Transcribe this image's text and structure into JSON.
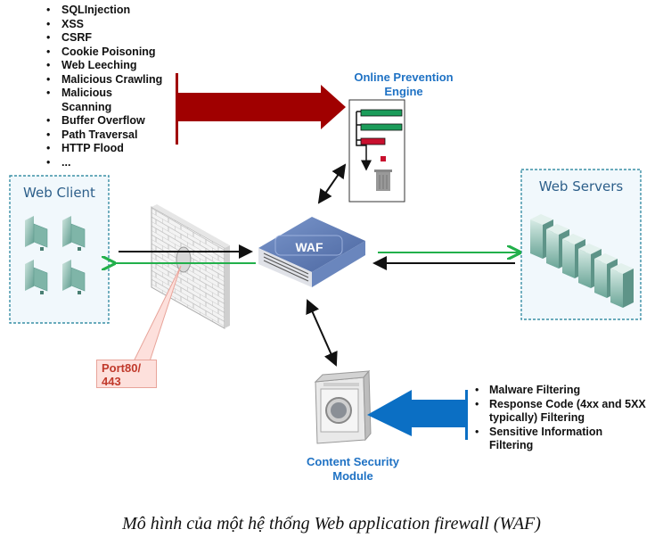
{
  "threats": {
    "items": [
      "SQLInjection",
      "XSS",
      "CSRF",
      "Cookie Poisoning",
      "Web Leeching",
      "Malicious Crawling",
      "Malicious Scanning",
      "Buffer Overflow",
      "Path Traversal",
      "HTTP Flood",
      "..."
    ]
  },
  "online_prevention_engine": {
    "label": "Online Prevention Engine"
  },
  "web_client": {
    "label": "Web Client",
    "client_count": 4
  },
  "web_servers": {
    "label": "Web Servers",
    "server_count": 6
  },
  "waf": {
    "label": "WAF"
  },
  "port": {
    "label_line1": "Port80/",
    "label_line2": "443"
  },
  "content_security_module": {
    "label": "Content Security Module"
  },
  "filters": {
    "items": [
      "Malware Filtering",
      "Response Code (4xx and 5XX typically) Filtering",
      "Sensitive Information Filtering"
    ]
  },
  "caption": "Mô hình của một hệ thống Web application firewall (WAF)",
  "colors": {
    "threat_arrow": "#a00000",
    "filter_arrow": "#0b6fc4",
    "request_line": "#111111",
    "response_line": "#22b04b",
    "label_blue": "#1f72c4",
    "waf_body": "#5a78b0",
    "zone_border": "#3a8fa5"
  }
}
